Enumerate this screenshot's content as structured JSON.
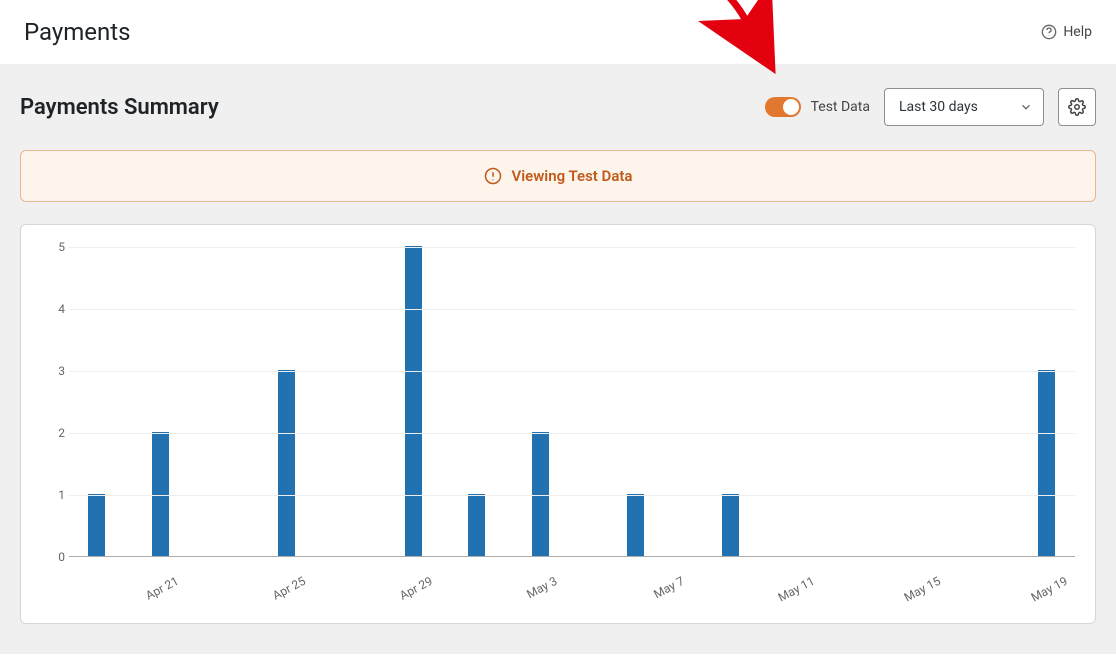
{
  "header": {
    "title": "Payments",
    "help_label": "Help"
  },
  "summary": {
    "title": "Payments Summary",
    "toggle_label": "Test Data",
    "toggle_on": true,
    "range_label": "Last 30 days"
  },
  "alert": {
    "text": "Viewing Test Data"
  },
  "chart_data": {
    "type": "bar",
    "title": "",
    "xlabel": "",
    "ylabel": "",
    "ylim": [
      0,
      5
    ],
    "yticks": [
      0,
      1,
      2,
      3,
      4,
      5
    ],
    "categories": [
      "Apr 19",
      "Apr 20",
      "Apr 21",
      "Apr 22",
      "Apr 23",
      "Apr 24",
      "Apr 25",
      "Apr 26",
      "Apr 27",
      "Apr 28",
      "Apr 29",
      "Apr 30",
      "May 1",
      "May 2",
      "May 3",
      "May 4",
      "May 5",
      "May 6",
      "May 7",
      "May 8",
      "May 9",
      "May 10",
      "May 11",
      "May 12",
      "May 13",
      "May 14",
      "May 15",
      "May 16",
      "May 17",
      "May 18",
      "May 19"
    ],
    "x_tick_labels": [
      "Apr 21",
      "Apr 25",
      "Apr 29",
      "May 3",
      "May 7",
      "May 11",
      "May 15",
      "May 19"
    ],
    "x_tick_indices": [
      2,
      6,
      10,
      14,
      18,
      22,
      26,
      30
    ],
    "values": [
      1,
      0,
      2,
      0,
      0,
      0,
      3,
      0,
      0,
      0,
      5,
      0,
      1,
      0,
      2,
      0,
      0,
      1,
      0,
      0,
      1,
      0,
      0,
      0,
      0,
      0,
      0,
      0,
      0,
      0,
      3
    ]
  },
  "colors": {
    "bar": "#2271b1",
    "accent": "#e27730",
    "alert_bg": "#fdf4ec",
    "alert_border": "#e7b991",
    "alert_text": "#c05a1a"
  }
}
